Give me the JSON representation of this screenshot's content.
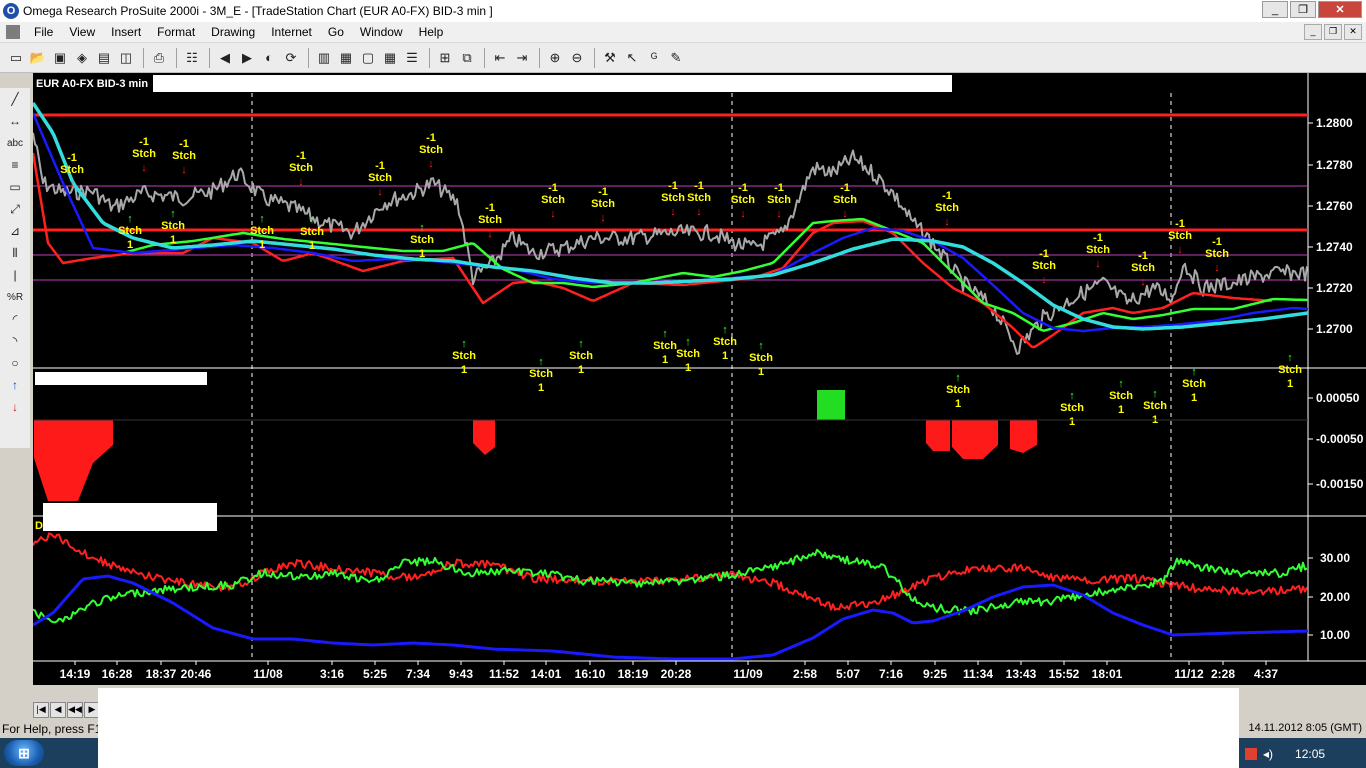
{
  "window": {
    "title": "Omega Research ProSuite 2000i - 3M_E - [TradeStation Chart (EUR A0-FX)  BID-3 min ]",
    "minimize": "_",
    "maximize": "❐",
    "close": "✕",
    "app_icon": "O"
  },
  "menu": [
    "File",
    "View",
    "Insert",
    "Format",
    "Drawing",
    "Internet",
    "Go",
    "Window",
    "Help"
  ],
  "mdi_controls": [
    "_",
    "❐",
    "✕"
  ],
  "toolbar_icons": [
    "new-icon",
    "open-icon",
    "save-icon",
    "open-workspace-icon",
    "save-workspace-icon",
    "print-preview-icon",
    "print-icon",
    "properties-icon",
    "back-icon",
    "forward-icon",
    "format-icon",
    "scroll-left-icon",
    "scroll-right-icon",
    "zoom-in-icon",
    "zoom-out-icon",
    "tools-icon",
    "pointer-icon",
    "bar-icon",
    "hat-icon"
  ],
  "drawing_tools": [
    "pen",
    "horizontal-line",
    "text",
    "vertical-lines",
    "rectangle",
    "trend-line",
    "fan-line",
    "gann-lines",
    "speed-lines",
    "percent-retracement",
    "fibonacci-arc",
    "arc",
    "ellipse",
    "up-arrow",
    "down-arrow"
  ],
  "drawing_tool_glyphs": [
    "╱",
    "↔",
    "abc",
    "≡",
    "▭",
    "⤢",
    "⊿",
    "⦀",
    "|",
    "%R",
    "◜",
    "◝",
    "○",
    "↑",
    "↓"
  ],
  "chart": {
    "symbol_label": "EUR A0-FX BID-3 min",
    "price_axis": [
      "1.2800",
      "1.2780",
      "1.2760",
      "1.2740",
      "1.2720",
      "1.2700"
    ],
    "osc_axis": [
      "0.00050",
      "-0.00050",
      "-0.00150"
    ],
    "dmi_axis": [
      "30.00",
      "20.00",
      "10.00"
    ],
    "time_axis": [
      "14:19",
      "16:28",
      "18:37",
      "20:46",
      "11/08",
      "3:16",
      "5:25",
      "7:34",
      "9:43",
      "11:52",
      "14:01",
      "16:10",
      "18:19",
      "20:28",
      "11/09",
      "2:58",
      "5:07",
      "7:16",
      "9:25",
      "11:34",
      "13:43",
      "15:52",
      "18:01",
      "11/12",
      "2:28",
      "4:37"
    ],
    "dmi_label": "D",
    "colors": {
      "background": "#000000",
      "price_bars": "#a8a8a8",
      "red_line": "#ff2020",
      "green_line": "#33ff33",
      "blue_line": "#1a1aff",
      "cyan_line": "#33dddd",
      "purple_line": "#c040c0",
      "signal_text": "#ffff00"
    },
    "signal_labels": {
      "short_top": "-1",
      "short_bottom": "Stch",
      "long_top": "Stch",
      "long_bottom": "1"
    }
  },
  "status": {
    "help": "For Help, press F1",
    "datetime": "14.11.2012 8:05 (GMT)",
    "clock": "12:05"
  },
  "nav_buttons": [
    "|◀",
    "◀",
    "◀◀",
    "▶",
    "▶▶",
    "▶|"
  ]
}
